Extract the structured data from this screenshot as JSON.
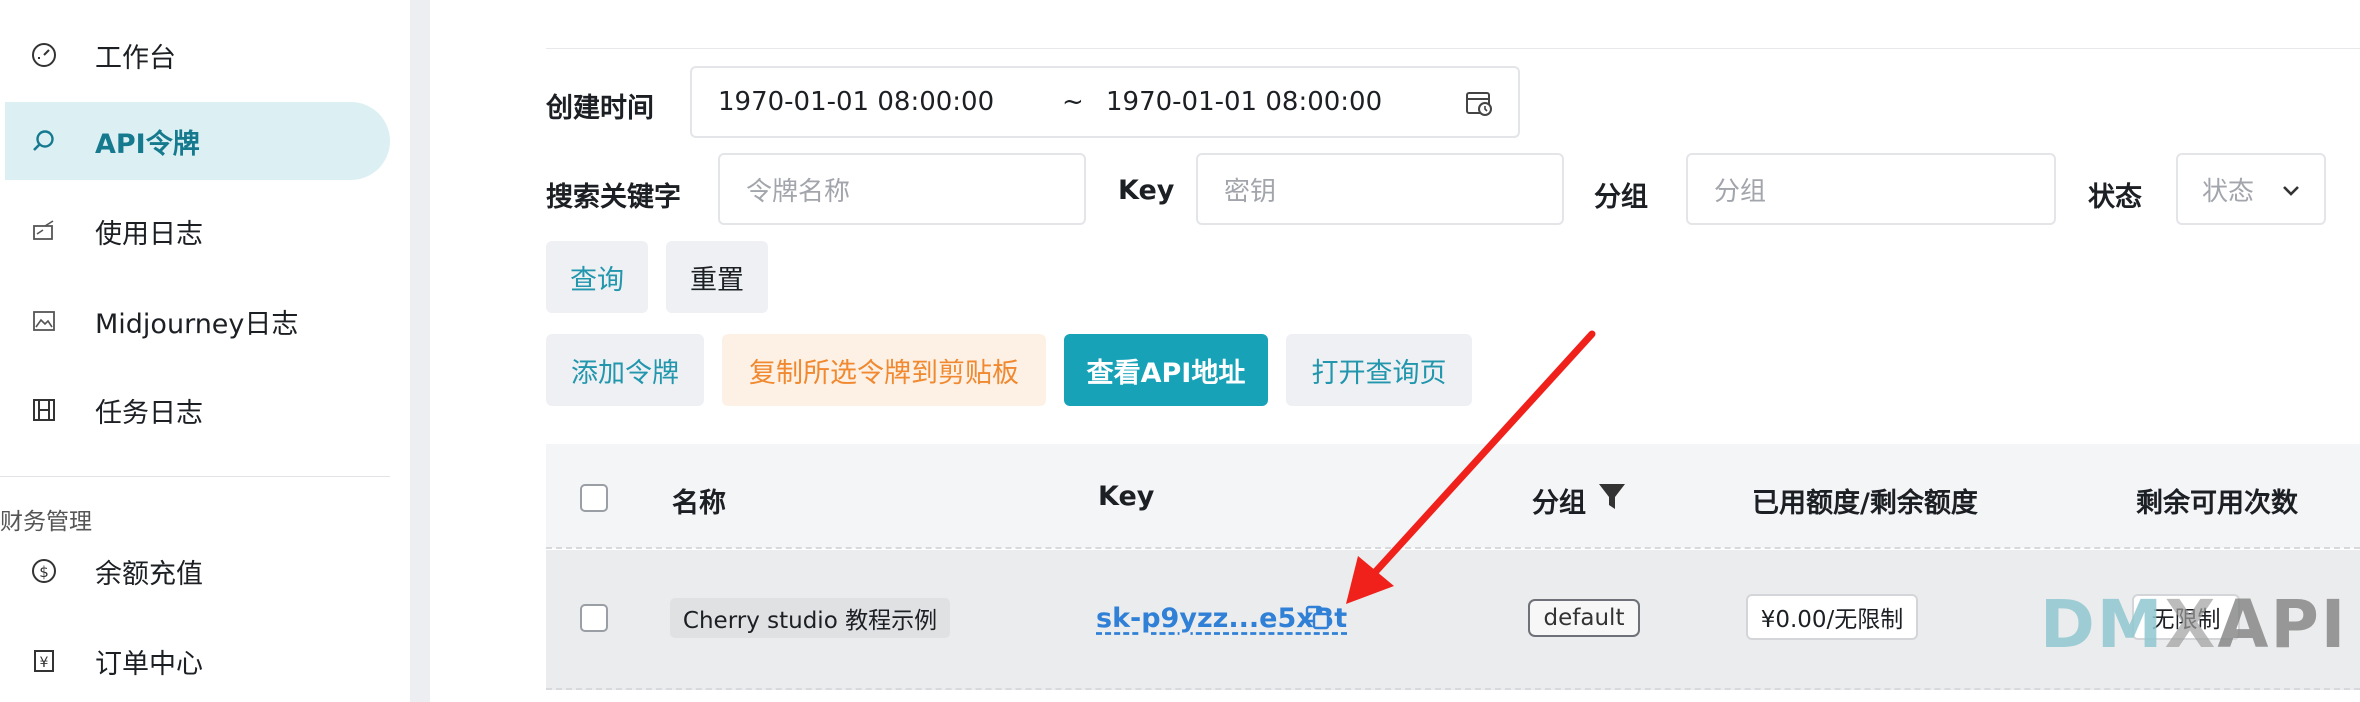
{
  "sidebar": {
    "items": [
      {
        "label": "工作台",
        "icon": "dashboard-icon"
      },
      {
        "label": "API令牌",
        "icon": "search-icon"
      },
      {
        "label": "使用日志",
        "icon": "log-icon"
      },
      {
        "label": "Midjourney日志",
        "icon": "image-icon"
      },
      {
        "label": "任务日志",
        "icon": "film-icon"
      }
    ],
    "section_title": "财务管理",
    "finance_items": [
      {
        "label": "余额充值",
        "icon": "dollar-circle-icon"
      },
      {
        "label": "订单中心",
        "icon": "yen-receipt-icon"
      }
    ]
  },
  "filters": {
    "created_time_label": "创建时间",
    "start_time": "1970-01-01 08:00:00",
    "range_separator": "~",
    "end_time": "1970-01-01 08:00:00",
    "search_label": "搜索关键字",
    "token_name_placeholder": "令牌名称",
    "key_label": "Key",
    "key_placeholder": "密钥",
    "group_label": "分组",
    "group_placeholder": "分组",
    "status_label": "状态",
    "status_placeholder": "状态"
  },
  "buttons": {
    "query": "查询",
    "reset": "重置",
    "add_token": "添加令牌",
    "copy_selected": "复制所选令牌到剪贴板",
    "view_api_address": "查看API地址",
    "open_query_page": "打开查询页"
  },
  "table": {
    "columns": [
      "名称",
      "Key",
      "分组",
      "已用额度/剩余额度",
      "剩余可用次数"
    ],
    "rows": [
      {
        "name": "Cherry studio 教程示例",
        "key": "sk-p9yzz...e5xBt",
        "group": "default",
        "quota": "¥0.00/无限制",
        "remaining": "无限制"
      }
    ]
  },
  "watermark": {
    "part1": "DM",
    "part2": "X",
    "part3": "API"
  },
  "colors": {
    "accent": "#17a2b8",
    "active_bg": "#dcf0f4",
    "arrow": "#f0201a",
    "orange": "#f0892f"
  }
}
